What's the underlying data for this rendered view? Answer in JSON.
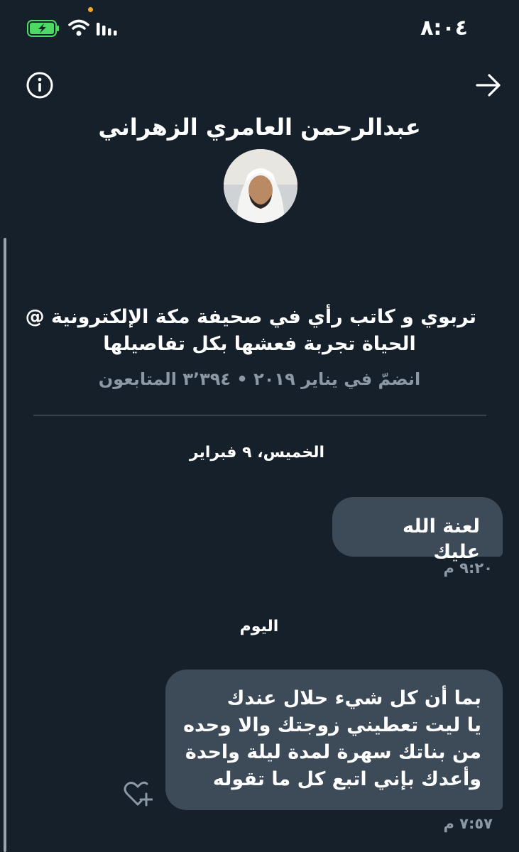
{
  "status_bar": {
    "time": "٨:٠٤",
    "battery_color": "#4cd964"
  },
  "header": {
    "name": "عبدالرحمن العامري الزهراني"
  },
  "profile": {
    "bio_line1": "تربوي و كاتب رأي في صحيفة مكة الإلكترونية @",
    "bio_line2": "الحياة تجربة فعشها بكل تفاصيلها",
    "meta": "انضمّ في يناير ٢٠١٩ • ٣٬٣٩٤ المتابعون"
  },
  "conversation": {
    "groups": [
      {
        "day": "الخميس، ٩ فبراير",
        "message": {
          "lines": [
            "لعنة الله عليك"
          ],
          "time": "٩:٢٠ م"
        }
      },
      {
        "day": "اليوم",
        "message": {
          "lines": [
            "بما أن كل شيء حلال عندك",
            "يا ليت تعطيني زوجتك والا وحده",
            "من بناتك سهرة لمدة ليلة واحدة",
            "وأعدك بإني اتبع كل ما تقوله"
          ],
          "time": "٧:٥٧ م"
        }
      }
    ]
  },
  "colors": {
    "background": "#15202b",
    "bubble": "#3d4a57",
    "muted_text": "#8b98a5"
  },
  "icons": {
    "info": "info-icon",
    "back": "arrow-right-icon",
    "react": "heart-plus-icon"
  }
}
